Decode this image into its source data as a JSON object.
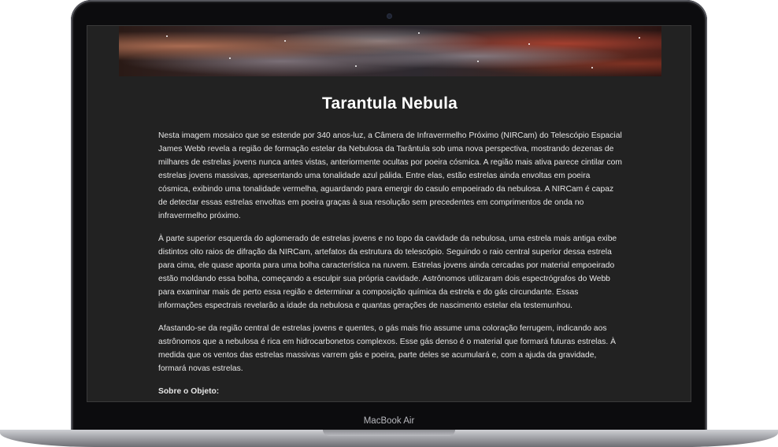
{
  "device": {
    "brand_label": "MacBook Air"
  },
  "page": {
    "title": "Tarantula Nebula",
    "paragraphs": [
      "Nesta imagem mosaico que se estende por 340 anos-luz, a Câmera de Infravermelho Próximo (NIRCam) do Telescópio Espacial James Webb revela a região de formação estelar da Nebulosa da Tarântula sob uma nova perspectiva, mostrando dezenas de milhares de estrelas jovens nunca antes vistas, anteriormente ocultas por poeira cósmica. A região mais ativa parece cintilar com estrelas jovens massivas, apresentando uma tonalidade azul pálida. Entre elas, estão estrelas ainda envoltas em poeira cósmica, exibindo uma tonalidade vermelha, aguardando para emergir do casulo empoeirado da nebulosa. A NIRCam é capaz de detectar essas estrelas envoltas em poeira graças à sua resolução sem precedentes em comprimentos de onda no infravermelho próximo.",
      "À parte superior esquerda do aglomerado de estrelas jovens e no topo da cavidade da nebulosa, uma estrela mais antiga exibe distintos oito raios de difração da NIRCam, artefatos da estrutura do telescópio. Seguindo o raio central superior dessa estrela para cima, ele quase aponta para uma bolha característica na nuvem. Estrelas jovens ainda cercadas por material empoeirado estão moldando essa bolha, começando a esculpir sua própria cavidade. Astrônomos utilizaram dois espectrógrafos do Webb para examinar mais de perto essa região e determinar a composição química da estrela e do gás circundante. Essas informações espectrais revelarão a idade da nebulosa e quantas gerações de nascimento estelar ela testemunhou.",
      "Afastando-se da região central de estrelas jovens e quentes, o gás mais frio assume uma coloração ferrugem, indicando aos astrônomos que a nebulosa é rica em hidrocarbonetos complexos. Esse gás denso é o material que formará futuras estrelas. À medida que os ventos das estrelas massivas varrem gás e poeira, parte deles se acumulará e, com a ajuda da gravidade, formará novas estrelas."
    ],
    "about_heading": "Sobre o Objeto:"
  },
  "colors": {
    "screen_bg": "#222222",
    "text": "#e6e6e6",
    "title": "#ffffff"
  }
}
